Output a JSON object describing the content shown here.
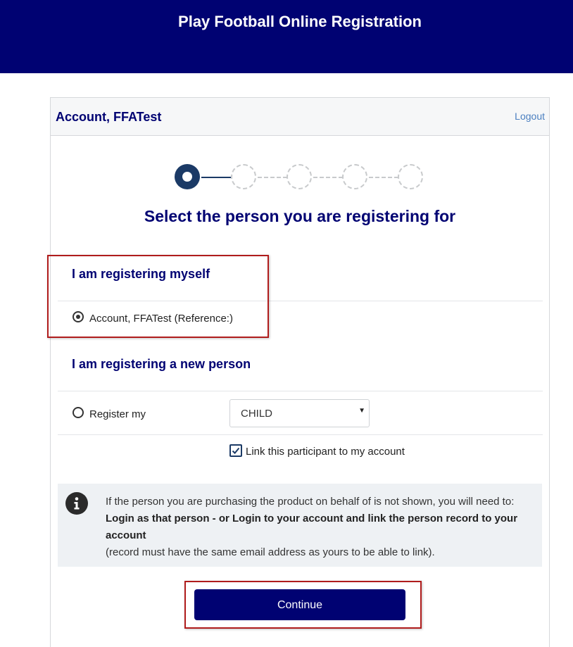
{
  "header": {
    "title": "Play Football Online Registration"
  },
  "card": {
    "account_name": "Account, FFATest",
    "logout_label": "Logout"
  },
  "stepper": {
    "total_steps": 5,
    "current_step": 1
  },
  "page_heading": "Select the person you are registering for",
  "myself_section": {
    "title": "I am registering myself",
    "option_label": "Account, FFATest (Reference:)",
    "selected": true
  },
  "new_person_section": {
    "title": "I am registering a new person",
    "option_label": "Register my",
    "selected": false,
    "relation_value": "CHILD",
    "link_label": "Link this participant to my account",
    "link_checked": true
  },
  "info": {
    "intro": "If the person you are purchasing the product on behalf of is not shown, you will need to: ",
    "bold": "Login as that person - or Login to your account and link the person record to your account",
    "note": "(record must have the same email address as yours to be able to link)."
  },
  "continue_label": "Continue",
  "colors": {
    "brand_navy": "#000272",
    "step_active": "#1b3a66",
    "highlight_red": "#b01c1c"
  }
}
